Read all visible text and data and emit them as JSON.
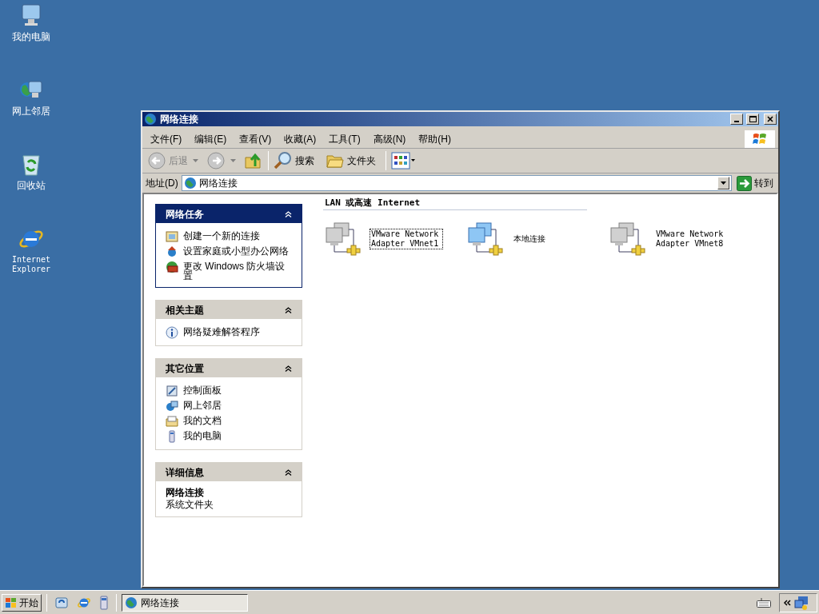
{
  "desktop_icons": [
    {
      "label": "我的电脑"
    },
    {
      "label": "网上邻居"
    },
    {
      "label": "回收站"
    },
    {
      "label": "Internet Explorer"
    }
  ],
  "window": {
    "title": "网络连接",
    "menu": [
      "文件(F)",
      "编辑(E)",
      "查看(V)",
      "收藏(A)",
      "工具(T)",
      "高级(N)",
      "帮助(H)"
    ],
    "toolbar": {
      "back": {
        "label": "后退",
        "disabled": true
      },
      "search": "搜索",
      "folders": "文件夹"
    },
    "address": {
      "label": "地址(D)",
      "value": "网络连接",
      "go": "转到"
    },
    "panels": [
      {
        "kind": "tasks",
        "title": "网络任务",
        "items": [
          "创建一个新的连接",
          "设置家庭或小型办公网络",
          "更改 Windows 防火墙设置"
        ]
      },
      {
        "kind": "normal",
        "title": "相关主题",
        "items": [
          "网络疑难解答程序"
        ]
      },
      {
        "kind": "normal",
        "title": "其它位置",
        "items": [
          "控制面板",
          "网上邻居",
          "我的文档",
          "我的电脑"
        ]
      },
      {
        "kind": "details",
        "title": "详细信息",
        "name": "网络连接",
        "description": "系统文件夹"
      }
    ],
    "group_heading": "LAN 或高速 Internet",
    "connections": [
      {
        "name": "VMware Network Adapter VMnet1",
        "enabled": false,
        "selected": true
      },
      {
        "name": "本地连接",
        "enabled": true,
        "selected": false
      },
      {
        "name": "VMware Network Adapter VMnet8",
        "enabled": false,
        "selected": false
      }
    ]
  },
  "taskbar": {
    "start": "开始",
    "task": "网络连接"
  }
}
